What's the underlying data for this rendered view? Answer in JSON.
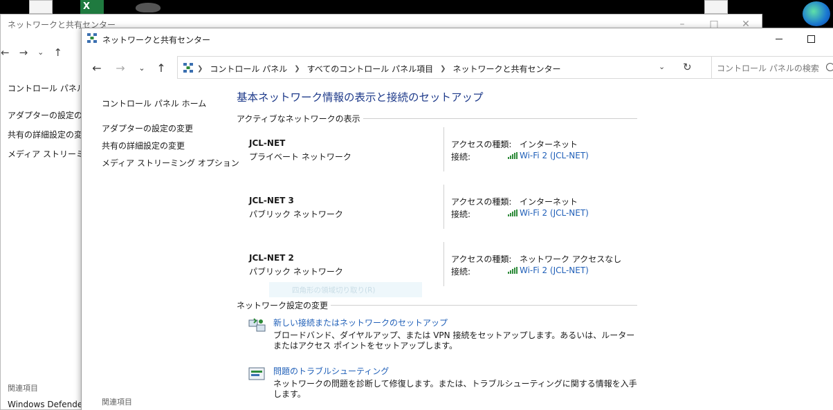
{
  "back_window": {
    "title": "ネットワークと共有センター",
    "links": [
      "コントロール パネル ホー",
      "アダプターの設定の変更",
      "共有の詳細設定の変更",
      "メディア ストリーミング オ"
    ],
    "related_heading": "関連項目",
    "related_link": "Windows Defender フ"
  },
  "window": {
    "title": "ネットワークと共有センター"
  },
  "address": {
    "crumbs": [
      "コントロール パネル",
      "すべてのコントロール パネル項目",
      "ネットワークと共有センター"
    ],
    "search_placeholder": "コントロール パネルの検索"
  },
  "left_pane": {
    "home": "コントロール パネル ホーム",
    "links": [
      "アダプターの設定の変更",
      "共有の詳細設定の変更",
      "メディア ストリーミング オプション"
    ],
    "related_heading": "関連項目"
  },
  "main": {
    "title": "基本ネットワーク情報の表示と接続のセットアップ",
    "active_header": "アクティブなネットワークの表示",
    "networks": [
      {
        "name": "JCL-NET",
        "type": "プライベート ネットワーク",
        "access_label": "アクセスの種類:",
        "access": "インターネット",
        "conn_label": "接続:",
        "conn": "Wi-Fi 2 (JCL-NET)"
      },
      {
        "name": "JCL-NET 3",
        "type": "パブリック ネットワーク",
        "access_label": "アクセスの種類:",
        "access": "インターネット",
        "conn_label": "接続:",
        "conn": "Wi-Fi 2 (JCL-NET)"
      },
      {
        "name": "JCL-NET 2",
        "type": "パブリック ネットワーク",
        "access_label": "アクセスの種類:",
        "access": "ネットワーク アクセスなし",
        "conn_label": "接続:",
        "conn": "Wi-Fi 2 (JCL-NET)"
      }
    ],
    "ghost_text": "四角形の領域切り取り(R)",
    "change_header": "ネットワーク設定の変更",
    "tasks": [
      {
        "link": "新しい接続またはネットワークのセットアップ",
        "desc": "ブロードバンド、ダイヤルアップ、または VPN 接続をセットアップします。あるいは、ルーターまたはアクセス ポイントをセットアップします。"
      },
      {
        "link": "問題のトラブルシューティング",
        "desc": "ネットワークの問題を診断して修復します。または、トラブルシューティングに関する情報を入手します。"
      }
    ]
  }
}
